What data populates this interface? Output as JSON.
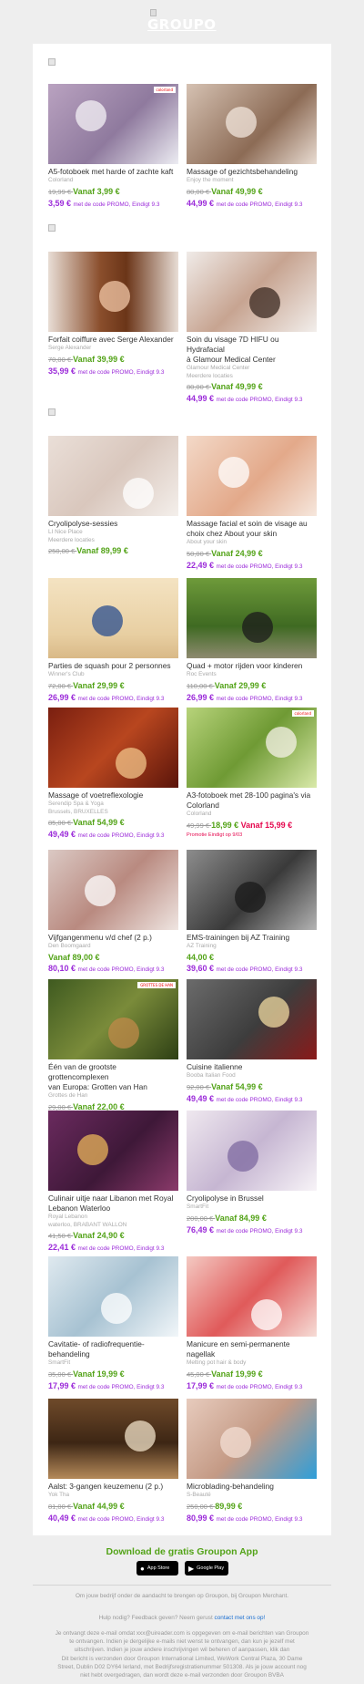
{
  "header": {
    "logo_text": "GROUPO"
  },
  "deals": [
    {
      "title": [
        "A5-fotoboek met harde of zachte kaft"
      ],
      "merchant": [
        "Colorland"
      ],
      "old_price": "19,99 €",
      "from_label": "Vanaf 3,99 €",
      "promo_price": "3,59 €",
      "promo_text": "met de code PROMO, Eindigt 9.3",
      "image": {
        "bg": "linear-gradient(135deg,#b9a2c0,#8f7a9e 55%,#ececf2)",
        "accent": "#f4f1f6",
        "tag": "colorland"
      }
    },
    {
      "title": [
        "Massage of gezichtsbehandeling"
      ],
      "merchant": [
        "Enjoy the moment"
      ],
      "old_price": "80,00 €",
      "from_label": "Vanaf 49,99 €",
      "promo_price": "44,99 €",
      "promo_text": "met de code PROMO, Eindigt 9.3",
      "image": {
        "bg": "linear-gradient(135deg,#d5c1b2,#8c6b55 60%,#e9dcd2)",
        "accent": "#f2e5dc"
      }
    },
    {
      "title": [
        "Forfait coiffure avec Serge Alexander"
      ],
      "merchant": [
        "Serge Alexander"
      ],
      "old_price": "70,00 €",
      "from_label": "Vanaf 39,99 €",
      "promo_price": "35,99 €",
      "promo_text": "met de code PROMO, Eindigt 9.3",
      "image": {
        "bg": "linear-gradient(90deg,#e8ddd5,#8a4e2c 40%,#6b3518 60%,#e8ddd5)",
        "accent": "#f1c7a7"
      }
    },
    {
      "title": [
        "Soin du visage 7D HIFU ou Hydrafacial",
        "à Glamour Medical Center"
      ],
      "merchant": [
        "Glamour Medical Center",
        "Meerdere locaties"
      ],
      "old_price": "80,00 €",
      "from_label": "Vanaf 49,99 €",
      "promo_price": "44,99 €",
      "promo_text": "met de code PROMO, Eindigt 9.3",
      "image": {
        "bg": "linear-gradient(135deg,#f0ebe8,#c7a491 50%,#f2eeeb)",
        "accent": "#3b2a22"
      }
    },
    {
      "title": [
        "Cryolipolyse-sessies"
      ],
      "merchant": [
        "LI Nice Place",
        "Meerdere locaties"
      ],
      "old_price": "250,00 €",
      "from_label": "Vanaf 89,99 €",
      "promo_price": "",
      "promo_text": "",
      "image": {
        "bg": "linear-gradient(135deg,#eadfd8,#d9c7bd 50%,#f4efeb)",
        "accent": "#ffffff"
      }
    },
    {
      "title": [
        "Massage facial et soin de visage au",
        "choix chez About your skin"
      ],
      "merchant": [
        "About your skin"
      ],
      "old_price": "50,00 €",
      "from_label": "Vanaf 24,99 €",
      "promo_price": "22,49 €",
      "promo_text": "met de code PROMO, Eindigt 9.3",
      "image": {
        "bg": "linear-gradient(135deg,#f3d9c8,#e3a98a 55%,#f6e7dd)",
        "accent": "#ffffff"
      }
    },
    {
      "title": [
        "Parties de squash pour 2 personnes"
      ],
      "merchant": [
        "Winner's Club"
      ],
      "old_price": "72,00 €",
      "from_label": "Vanaf 29,99 €",
      "promo_price": "26,99 €",
      "promo_text": "met de code PROMO, Eindigt 9.3",
      "image": {
        "bg": "linear-gradient(180deg,#f4e3c2,#e8cfa2 70%,#d9b987)",
        "accent": "#2a4d8f"
      }
    },
    {
      "title": [
        "Quad + motor rijden voor kinderen"
      ],
      "merchant": [
        "Roc Events"
      ],
      "old_price": "110,00 €",
      "from_label": "Vanaf 29,99 €",
      "promo_price": "26,99 €",
      "promo_text": "met de code PROMO, Eindigt 9.3",
      "image": {
        "bg": "linear-gradient(180deg,#6e9a3a,#3f6a22 60%,#8e8a70)",
        "accent": "#1b1b1b"
      }
    },
    {
      "title": [
        "Massage of voetreflexologie"
      ],
      "merchant": [
        "Serendip Spa & Yoga",
        "Brussels, BRUXELLES"
      ],
      "old_price": "85,00 €",
      "from_label": "Vanaf 54,99 €",
      "promo_price": "49,49 €",
      "promo_text": "met de code PROMO, Eindigt 9.3",
      "image": {
        "bg": "linear-gradient(135deg,#7a1f10,#b8461f 50%,#5a140a)",
        "accent": "#f1c48a"
      }
    },
    {
      "title": [
        "A3-fotoboek met 28-100 pagina's via",
        "Colorland"
      ],
      "merchant": [
        "Colorland"
      ],
      "old_price": "49,99 €",
      "from_label": "18,99 €",
      "promo_price": "Vanaf 15,99 €",
      "promo_text": "",
      "promo_note": "Promotie Eindigt op 9/03",
      "image": {
        "bg": "linear-gradient(135deg,#b7d37a,#6f9a34 50%,#d9e9a9)",
        "accent": "#f6f2e8",
        "tag": "colorland"
      }
    },
    {
      "title": [
        "Vijfgangenmenu v/d chef (2 p.)"
      ],
      "merchant": [
        "Den Boomgaard"
      ],
      "old_price": "",
      "from_label": "Vanaf 89,00 €",
      "promo_price": "80,10 €",
      "promo_text": "met de code PROMO, Eindigt 9.3",
      "image": {
        "bg": "linear-gradient(135deg,#dbc9c4,#b98a80 50%,#efe5e1)",
        "accent": "#ffffff"
      }
    },
    {
      "title": [
        "EMS-trainingen bij AZ Training"
      ],
      "merchant": [
        "AZ Training"
      ],
      "old_price": "",
      "from_label": "44,00 €",
      "promo_price": "39,60 €",
      "promo_text": "met de code PROMO, Eindigt 9.3",
      "image": {
        "bg": "linear-gradient(135deg,#8d8d8d,#3a3a3a 55%,#b3b3b3)",
        "accent": "#1a1a1a"
      }
    },
    {
      "title": [
        "Één van de grootste grottencomplexen",
        "van Europa: Grotten van Han"
      ],
      "merchant": [
        "Grottes de Han"
      ],
      "old_price": "29,00 €",
      "from_label": "Vanaf 22,00 €",
      "promo_price": "",
      "promo_text": "",
      "image": {
        "bg": "linear-gradient(135deg,#3f5a20,#7a8b3a 50%,#2d3f14)",
        "accent": "#c08a4a",
        "tag": "GROTTES DE HAN"
      }
    },
    {
      "title": [
        "Cuisine italienne"
      ],
      "merchant": [
        "Booba Italian Food"
      ],
      "old_price": "92,00 €",
      "from_label": "Vanaf 54,99 €",
      "promo_price": "49,49 €",
      "promo_text": "met de code PROMO, Eindigt 9.3",
      "image": {
        "bg": "linear-gradient(135deg,#6b6b6b,#3d3d3d 55%,#8a1a1a)",
        "accent": "#f0d9a0"
      }
    },
    {
      "title": [
        "Culinair uitje naar Libanon met Royal",
        "Lebanon Waterloo"
      ],
      "merchant": [
        "Royal Lebanon",
        "waterloo, BRABANT WALLON"
      ],
      "old_price": "41,50 €",
      "from_label": "Vanaf 24,90 €",
      "promo_price": "22,41 €",
      "promo_text": "met de code PROMO, Eindigt 9.3",
      "image": {
        "bg": "linear-gradient(135deg,#6a2a5e,#3e1838 55%,#8a3a6a)",
        "accent": "#e8b45a"
      }
    },
    {
      "title": [
        "Cryolipolyse in Brussel"
      ],
      "merchant": [
        "SmartFit"
      ],
      "old_price": "200,00 €",
      "from_label": "Vanaf 84,99 €",
      "promo_price": "76,49 €",
      "promo_text": "met de code PROMO, Eindigt 9.3",
      "image": {
        "bg": "linear-gradient(135deg,#efe8ef,#c6b6d2 50%,#f7f3f7)",
        "accent": "#7d6aa0"
      }
    },
    {
      "title": [
        "Cavitatie- of radiofrequentie-",
        "behandeling"
      ],
      "merchant": [
        "SmartFit"
      ],
      "old_price": "35,00 €",
      "from_label": "Vanaf 19,99 €",
      "promo_price": "17,99 €",
      "promo_text": "met de code PROMO, Eindigt 9.3",
      "image": {
        "bg": "linear-gradient(135deg,#dfe9ef,#a7c2d2 50%,#f1f6f9)",
        "accent": "#ffffff"
      }
    },
    {
      "title": [
        "Manicure en semi-permanente",
        "nagellak"
      ],
      "merchant": [
        "Melting pot hair & body"
      ],
      "old_price": "45,00 €",
      "from_label": "Vanaf 19,99 €",
      "promo_price": "17,99 €",
      "promo_text": "met de code PROMO, Eindigt 9.3",
      "image": {
        "bg": "linear-gradient(135deg,#f4c9c2,#e05a5a 50%,#f6dcd6)",
        "accent": "#ffffff"
      }
    },
    {
      "title": [
        "Aalst: 3-gangen keuzemenu (2 p.)"
      ],
      "merchant": [
        "Yok Tha"
      ],
      "old_price": "81,00 €",
      "from_label": "Vanaf 44,99 €",
      "promo_price": "40,49 €",
      "promo_text": "met de code PROMO, Eindigt 9.3",
      "image": {
        "bg": "linear-gradient(180deg,#6f4a2a,#3d2614 55%,#b58a5a)",
        "accent": "#f0e2c8"
      }
    },
    {
      "title": [
        "Microblading-behandeling"
      ],
      "merchant": [
        "S-Beauté"
      ],
      "old_price": "250,00 €",
      "from_label": "89,99 €",
      "promo_price": "80,99 €",
      "promo_text": "met de code PROMO, Eindigt 9.3",
      "image": {
        "bg": "linear-gradient(135deg,#e7cbbd,#c49a85 50%,#2e9ed9)",
        "accent": "#f3dfd4"
      }
    }
  ],
  "app": {
    "title": "Download de gratis Groupon App",
    "app_store_label": "App Store",
    "google_play_label": "Google Play"
  },
  "footer": {
    "line1": "Om jouw bedrijf onder de aandacht te brengen op Groupon, bij Groupon Merchant.",
    "help_text": "Hulp nodig? Feedback geven? Neem gerust",
    "help_link": "contact met ons op!",
    "line3": "Je ontvangt deze e-mail omdat xxx@uireader.com is opgegeven om e-mail berichten van Groupon te ontvangen. Indien je dergelijke e-mails niet wenst te ontvangen, dan kun je jezelf met uitschrijven. Indien je jouw andere inschrijvingen wil beheren of aanpassen, klik dan",
    "line4": "Dit bericht is verzonden door Groupon International Limited, WeWork Central Plaza, 30 Dame Street, Dublin D02 DY64 Ierland, met Bedrijfsregistratienummer 501308. Als je jouw account nog niet hebt overgedragen, dan wordt deze e-mail verzonden door Groupon BVBA"
  }
}
